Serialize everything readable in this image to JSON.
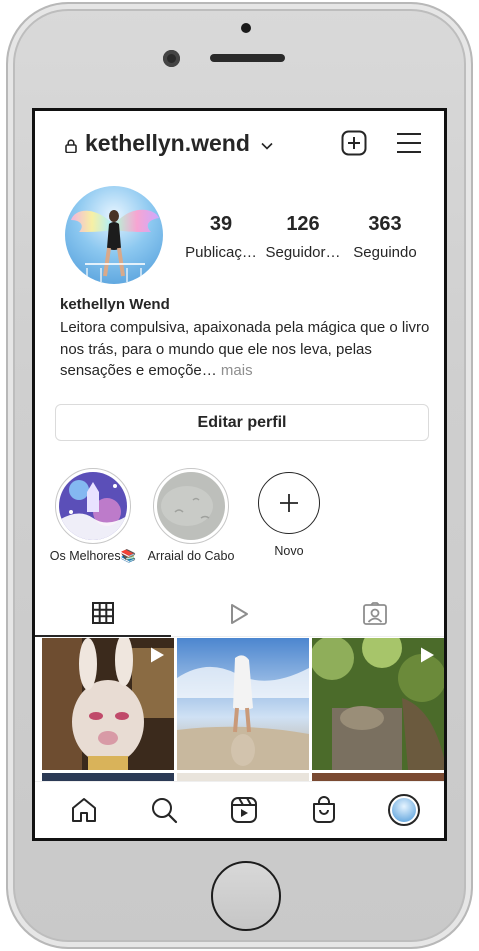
{
  "header": {
    "username": "kethellyn.wend"
  },
  "profile": {
    "name": "kethellyn Wend",
    "bio": "Leitora compulsiva, apaixonada pela mágica que o livro nos trás, para o mundo que ele nos leva, pelas sensações e emoçõe…",
    "bio_more": " mais",
    "stats": [
      {
        "value": "39",
        "label": "Publicaç…"
      },
      {
        "value": "126",
        "label": "Seguidor…"
      },
      {
        "value": "363",
        "label": "Seguindo"
      }
    ],
    "edit_label": "Editar perfil"
  },
  "highlights": [
    {
      "label": "Os Melhores📚"
    },
    {
      "label": "Arraial do Cabo"
    },
    {
      "label": "Novo"
    }
  ],
  "tabs": [
    {
      "icon": "grid-icon",
      "active": true
    },
    {
      "icon": "reels-icon",
      "active": false
    },
    {
      "icon": "tagged-icon",
      "active": false
    }
  ],
  "grid": [
    {
      "kind": "reel",
      "palette": [
        "#3b2a1c",
        "#a78057",
        "#e8dcd3"
      ]
    },
    {
      "kind": "photo",
      "palette": [
        "#5a8fd0",
        "#d7e6f5",
        "#b5a892"
      ]
    },
    {
      "kind": "reel",
      "palette": [
        "#4b6b2a",
        "#8fae5a",
        "#6b5a3e"
      ]
    }
  ],
  "nav": [
    "home-icon",
    "search-icon",
    "reels-icon",
    "shop-icon",
    "profile-avatar"
  ],
  "colors": {
    "text": "#262626",
    "muted": "#8e8e8e",
    "border": "#dbdbdb"
  }
}
